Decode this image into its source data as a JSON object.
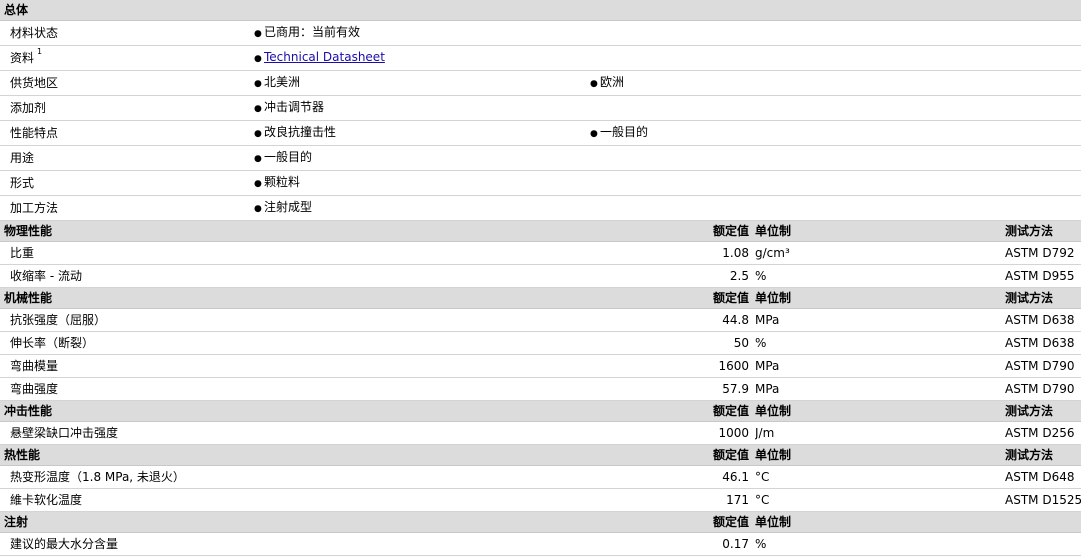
{
  "general": {
    "title": "总体",
    "rows": [
      {
        "label": "材料状态",
        "values": [
          "已商用：当前有效"
        ]
      },
      {
        "label": "资料",
        "sup": "1",
        "link": "Technical Datasheet"
      },
      {
        "label": "供货地区",
        "values": [
          "北美洲",
          "欧洲"
        ]
      },
      {
        "label": "添加剂",
        "values": [
          "冲击调节器"
        ]
      },
      {
        "label": "性能特点",
        "values": [
          "改良抗撞击性",
          "一般目的"
        ]
      },
      {
        "label": "用途",
        "values": [
          "一般目的"
        ]
      },
      {
        "label": "形式",
        "values": [
          "颗粒料"
        ]
      },
      {
        "label": "加工方法",
        "values": [
          "注射成型"
        ]
      }
    ]
  },
  "headers": {
    "nominal": "额定值",
    "unit": "单位制",
    "method": "测试方法"
  },
  "sections": [
    {
      "title": "物理性能",
      "show_method": true,
      "rows": [
        {
          "label": "比重",
          "value": "1.08",
          "unit": "g/cm³",
          "method": "ASTM D792"
        },
        {
          "label": "收缩率 - 流动",
          "value": "2.5",
          "unit": "%",
          "method": "ASTM D955"
        }
      ]
    },
    {
      "title": "机械性能",
      "show_method": true,
      "rows": [
        {
          "label": "抗张强度（屈服）",
          "value": "44.8",
          "unit": "MPa",
          "method": "ASTM D638"
        },
        {
          "label": "伸长率（断裂）",
          "value": "50",
          "unit": "%",
          "method": "ASTM D638"
        },
        {
          "label": "弯曲模量",
          "value": "1600",
          "unit": "MPa",
          "method": "ASTM D790"
        },
        {
          "label": "弯曲强度",
          "value": "57.9",
          "unit": "MPa",
          "method": "ASTM D790"
        }
      ]
    },
    {
      "title": "冲击性能",
      "show_method": true,
      "rows": [
        {
          "label": "悬壁梁缺口冲击强度",
          "value": "1000",
          "unit": "J/m",
          "method": "ASTM D256"
        }
      ]
    },
    {
      "title": "热性能",
      "show_method": true,
      "rows": [
        {
          "label": "热变形温度（1.8 MPa, 未退火）",
          "value": "46.1",
          "unit": "°C",
          "method": "ASTM D648"
        },
        {
          "label": "維卡软化温度",
          "value": "171",
          "unit": "°C",
          "method": "ASTM D1525"
        }
      ]
    },
    {
      "title": "注射",
      "show_method": false,
      "rows": [
        {
          "label": "建议的最大水分含量",
          "value": "0.17",
          "unit": "%",
          "method": ""
        }
      ]
    }
  ]
}
